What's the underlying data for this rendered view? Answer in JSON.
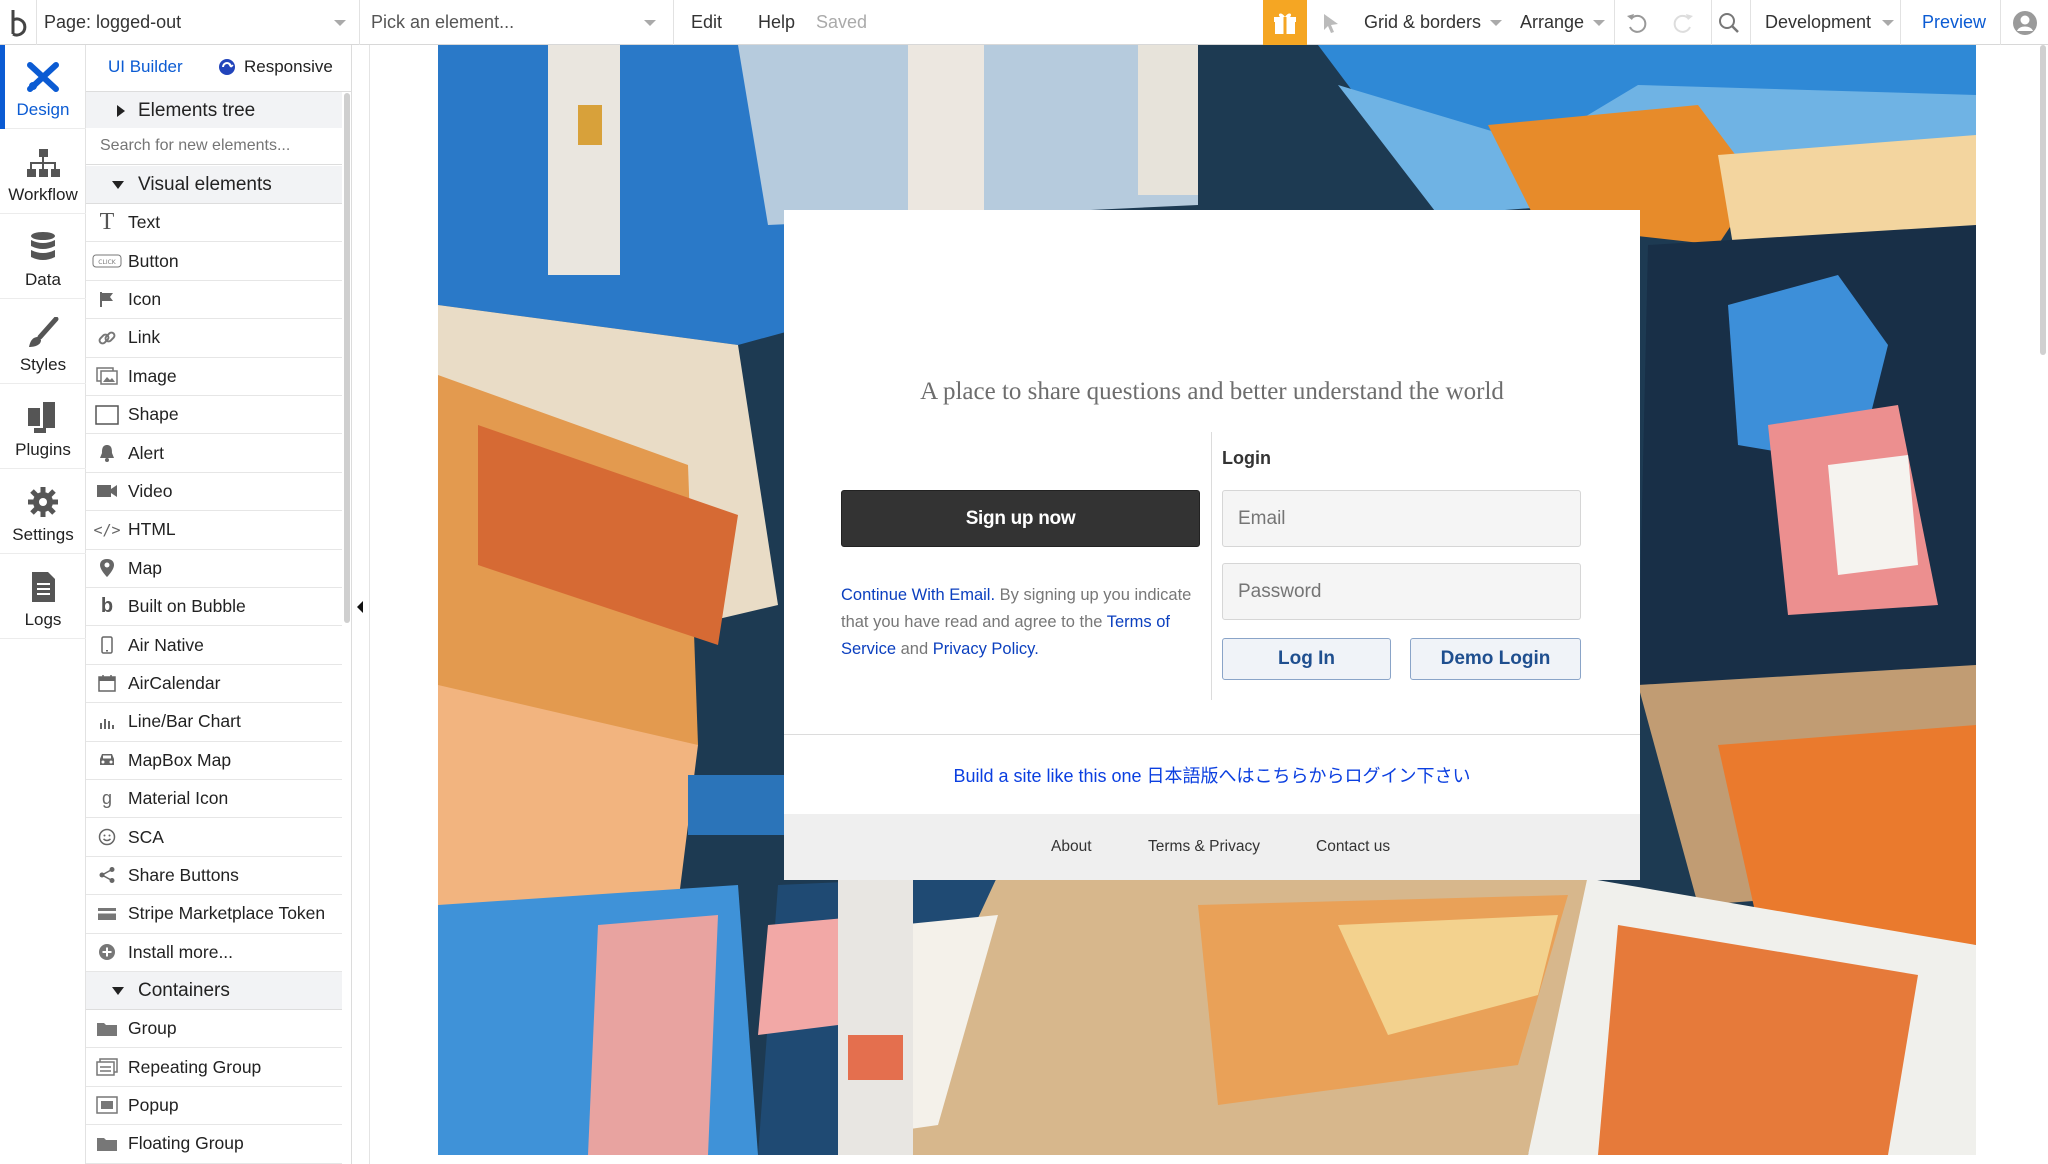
{
  "topbar": {
    "page_label": "Page: logged-out",
    "element_picker_placeholder": "Pick an element...",
    "edit": "Edit",
    "help": "Help",
    "saved_status": "Saved",
    "grid_borders": "Grid & borders",
    "arrange": "Arrange",
    "environment": "Development",
    "preview": "Preview"
  },
  "rail": {
    "items": [
      {
        "label": "Design",
        "icon": "design-icon"
      },
      {
        "label": "Workflow",
        "icon": "workflow-icon"
      },
      {
        "label": "Data",
        "icon": "database-icon"
      },
      {
        "label": "Styles",
        "icon": "brush-icon"
      },
      {
        "label": "Plugins",
        "icon": "plug-icon"
      },
      {
        "label": "Settings",
        "icon": "gear-icon"
      },
      {
        "label": "Logs",
        "icon": "document-icon"
      }
    ]
  },
  "palette": {
    "tab_builder": "UI Builder",
    "tab_responsive": "Responsive",
    "elements_tree": "Elements tree",
    "search_placeholder": "Search for new elements...",
    "visual_elements_header": "Visual elements",
    "visual_elements": [
      {
        "label": "Text",
        "icon": "text-icon"
      },
      {
        "label": "Button",
        "icon": "button-icon"
      },
      {
        "label": "Icon",
        "icon": "flag-icon"
      },
      {
        "label": "Link",
        "icon": "link-icon"
      },
      {
        "label": "Image",
        "icon": "image-icon"
      },
      {
        "label": "Shape",
        "icon": "shape-icon"
      },
      {
        "label": "Alert",
        "icon": "bell-icon"
      },
      {
        "label": "Video",
        "icon": "video-icon"
      },
      {
        "label": "HTML",
        "icon": "code-icon"
      },
      {
        "label": "Map",
        "icon": "map-pin-icon"
      },
      {
        "label": "Built on Bubble",
        "icon": "bubble-icon"
      },
      {
        "label": "Air Native",
        "icon": "phone-icon"
      },
      {
        "label": "AirCalendar",
        "icon": "calendar-icon"
      },
      {
        "label": "Line/Bar Chart",
        "icon": "chart-icon"
      },
      {
        "label": "MapBox Map",
        "icon": "car-icon"
      },
      {
        "label": "Material Icon",
        "icon": "material-icon"
      },
      {
        "label": "SCA",
        "icon": "smiley-icon"
      },
      {
        "label": "Share Buttons",
        "icon": "share-icon"
      },
      {
        "label": "Stripe Marketplace Token",
        "icon": "stripe-icon"
      },
      {
        "label": "Install more...",
        "icon": "plus-circle-icon"
      }
    ],
    "containers_header": "Containers",
    "containers": [
      {
        "label": "Group",
        "icon": "folder-icon"
      },
      {
        "label": "Repeating Group",
        "icon": "repeating-group-icon"
      },
      {
        "label": "Popup",
        "icon": "popup-icon"
      },
      {
        "label": "Floating Group",
        "icon": "floating-group-icon"
      }
    ]
  },
  "card": {
    "tagline": "A place to share questions and better understand the world",
    "signup_button": "Sign up now",
    "legal_link": "Continue With Email.",
    "legal_text_1": " By signing up you indicate that you have read and agree to the ",
    "terms_link": "Terms of Service",
    "legal_and": " and ",
    "privacy_link": "Privacy Policy.",
    "login_title": "Login",
    "email_placeholder": "Email",
    "password_placeholder": "Password",
    "login_button": "Log In",
    "demo_button": "Demo Login",
    "build_line": "Build a site like this one 日本語版へはこちらからログイン下さい",
    "footer_links": [
      "About",
      "Terms & Privacy",
      "Contact us"
    ]
  },
  "colors": {
    "accent": "#0b5bd3",
    "gift_button": "#f5a623",
    "signup_button": "#333333"
  }
}
